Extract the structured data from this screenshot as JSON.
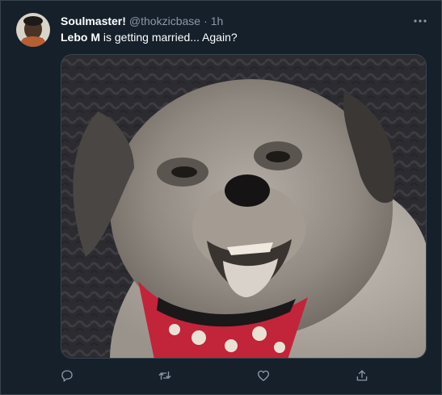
{
  "tweet": {
    "author_name": "Soulmaster!",
    "author_handle": "@thokzicbase",
    "separator": "·",
    "time": "1h",
    "text_bold": "Lebo M",
    "text_rest": " is getting married... Again?"
  },
  "icons": {
    "more": "more-icon",
    "reply": "reply-icon",
    "retweet": "retweet-icon",
    "like": "like-icon",
    "share": "share-icon"
  },
  "colors": {
    "background": "#15202b",
    "text_primary": "#ffffff",
    "text_secondary": "#8b98a5",
    "border": "#38444d"
  }
}
